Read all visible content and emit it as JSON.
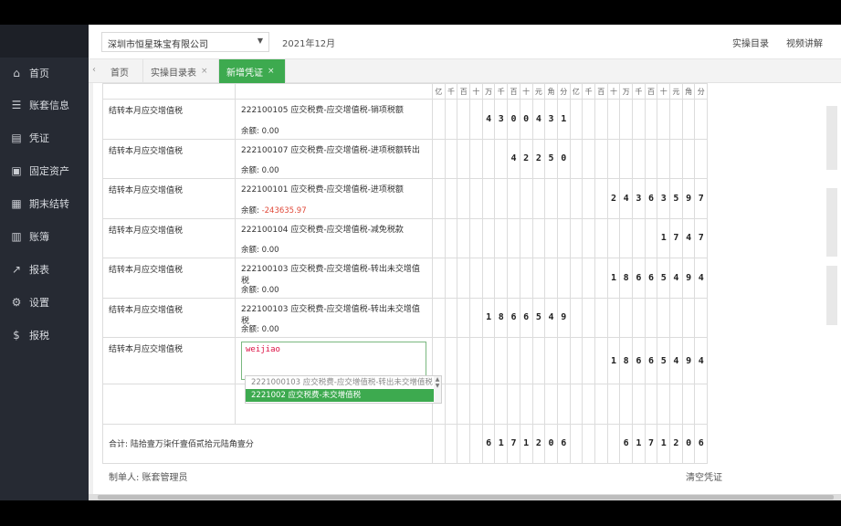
{
  "sidebar": {
    "items": [
      {
        "label": "首页",
        "icon": "home-icon",
        "glyph": "⌂"
      },
      {
        "label": "账套信息",
        "icon": "sliders-icon",
        "glyph": "☰"
      },
      {
        "label": "凭证",
        "icon": "document-icon",
        "glyph": "▤"
      },
      {
        "label": "固定资产",
        "icon": "asset-icon",
        "glyph": "▣"
      },
      {
        "label": "期末结转",
        "icon": "calendar-icon",
        "glyph": "▦"
      },
      {
        "label": "账簿",
        "icon": "book-icon",
        "glyph": "▥"
      },
      {
        "label": "报表",
        "icon": "chart-icon",
        "glyph": "↗"
      },
      {
        "label": "设置",
        "icon": "gear-icon",
        "glyph": "⚙"
      },
      {
        "label": "报税",
        "icon": "tax-icon",
        "glyph": "$"
      }
    ]
  },
  "header": {
    "company": "深圳市恒星珠宝有限公司",
    "period": "2021年12月",
    "link1": "实操目录",
    "link2": "视频讲解"
  },
  "tabs": [
    {
      "label": "首页",
      "closable": false
    },
    {
      "label": "实操目录表",
      "closable": true
    },
    {
      "label": "新增凭证",
      "closable": true,
      "active": true
    }
  ],
  "digit_headers": [
    "亿",
    "千",
    "百",
    "十",
    "万",
    "千",
    "百",
    "十",
    "元",
    "角",
    "分"
  ],
  "rows": [
    {
      "summary": "结转本月应交增值税",
      "account": "222100105 应交税费-应交增值税-销项税额",
      "balance_label": "余额:",
      "balance": "0.00",
      "debit": "4300431",
      "credit": ""
    },
    {
      "summary": "结转本月应交增值税",
      "account": "222100107 应交税费-应交增值税-进项税额转出",
      "balance_label": "余额:",
      "balance": "0.00",
      "debit": "42250",
      "credit": ""
    },
    {
      "summary": "结转本月应交增值税",
      "account": "222100101 应交税费-应交增值税-进项税额",
      "balance_label": "余额:",
      "balance": "-243635.97",
      "negative": true,
      "debit": "",
      "credit": "24363597"
    },
    {
      "summary": "结转本月应交增值税",
      "account": "222100104 应交税费-应交增值税-减免税款",
      "balance_label": "余额:",
      "balance": "0.00",
      "debit": "",
      "credit": "1747"
    },
    {
      "summary": "结转本月应交增值税",
      "account": "222100103 应交税费-应交增值税-转出未交增值税",
      "balance_label": "余额:",
      "balance": "0.00",
      "debit": "",
      "credit": "18665494"
    },
    {
      "summary": "结转本月应交增值税",
      "account": "222100103 应交税费-应交增值税-转出未交增值税",
      "balance_label": "余额:",
      "balance": "0.00",
      "debit": "1866549",
      "credit": ""
    },
    {
      "summary": "结转本月应交增值税",
      "account_input": "weijiao",
      "debit": "",
      "credit": "18665494"
    }
  ],
  "dropdown": {
    "options": [
      "2221000103 应交税费-应交增值税-转出未交增值税",
      "2221002 应交税费-未交增值税"
    ],
    "selected_index": 1
  },
  "total": {
    "label": "合计: 陆拾壹万柒仟壹佰贰拾元陆角壹分",
    "debit": "6171206",
    "credit": "6171206"
  },
  "footer": {
    "maker": "制单人: 账套管理员",
    "clear": "清空凭证"
  }
}
